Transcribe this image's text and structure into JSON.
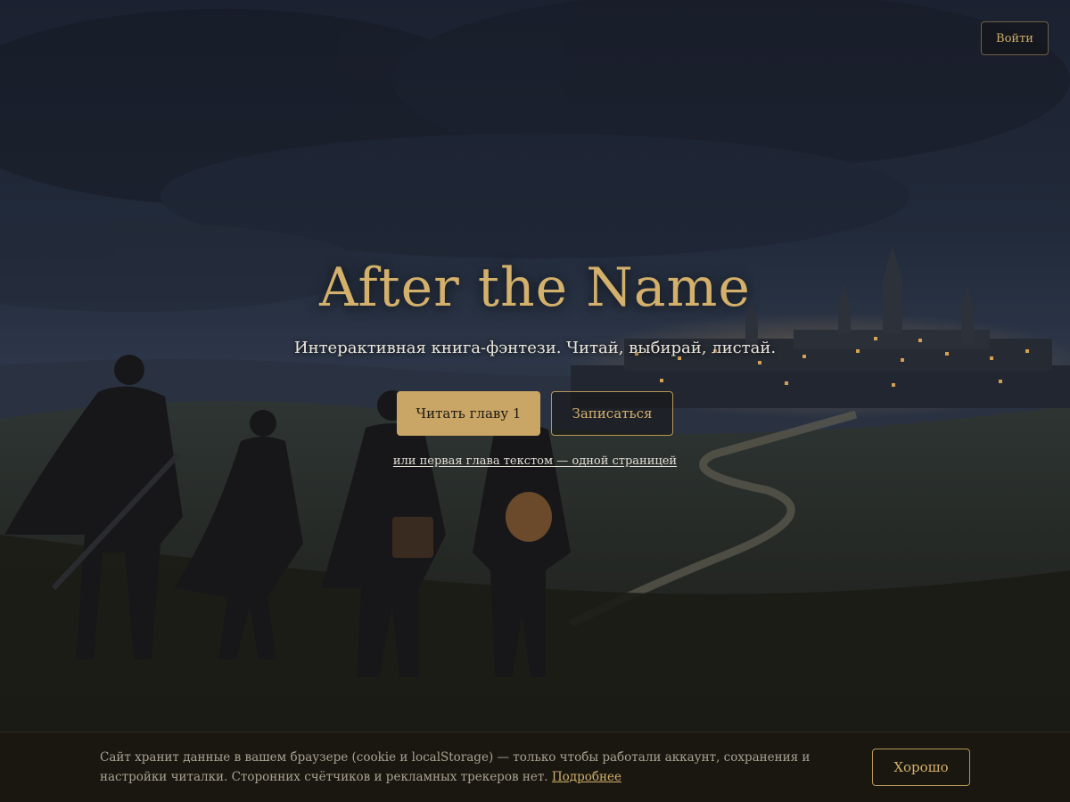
{
  "header": {
    "login_label": "Войти"
  },
  "hero": {
    "title": "After the Name",
    "subtitle": "Интерактивная книга-фэнтези. Читай, выбирай, листай.",
    "primary_button": "Читать главу 1",
    "secondary_button": "Записаться",
    "text_link": "или первая глава текстом — одной страницей"
  },
  "background": {
    "illustration": "fantasy-landscape",
    "elements": [
      "storm-clouds",
      "castle-city",
      "winding-road",
      "four-travelers"
    ]
  },
  "cookie_banner": {
    "text": "Сайт хранит данные в вашем браузере (cookie и localStorage) — только чтобы работали аккаунт, сохранения и настройки читалки. Сторонних счётчиков и рекламных трекеров нет.",
    "more_link": "Подробнее",
    "accept_button": "Хорошо"
  },
  "colors": {
    "accent_gold": "#c9a566",
    "title_gold": "#d3b06b",
    "banner_bg": "#1a1710"
  }
}
